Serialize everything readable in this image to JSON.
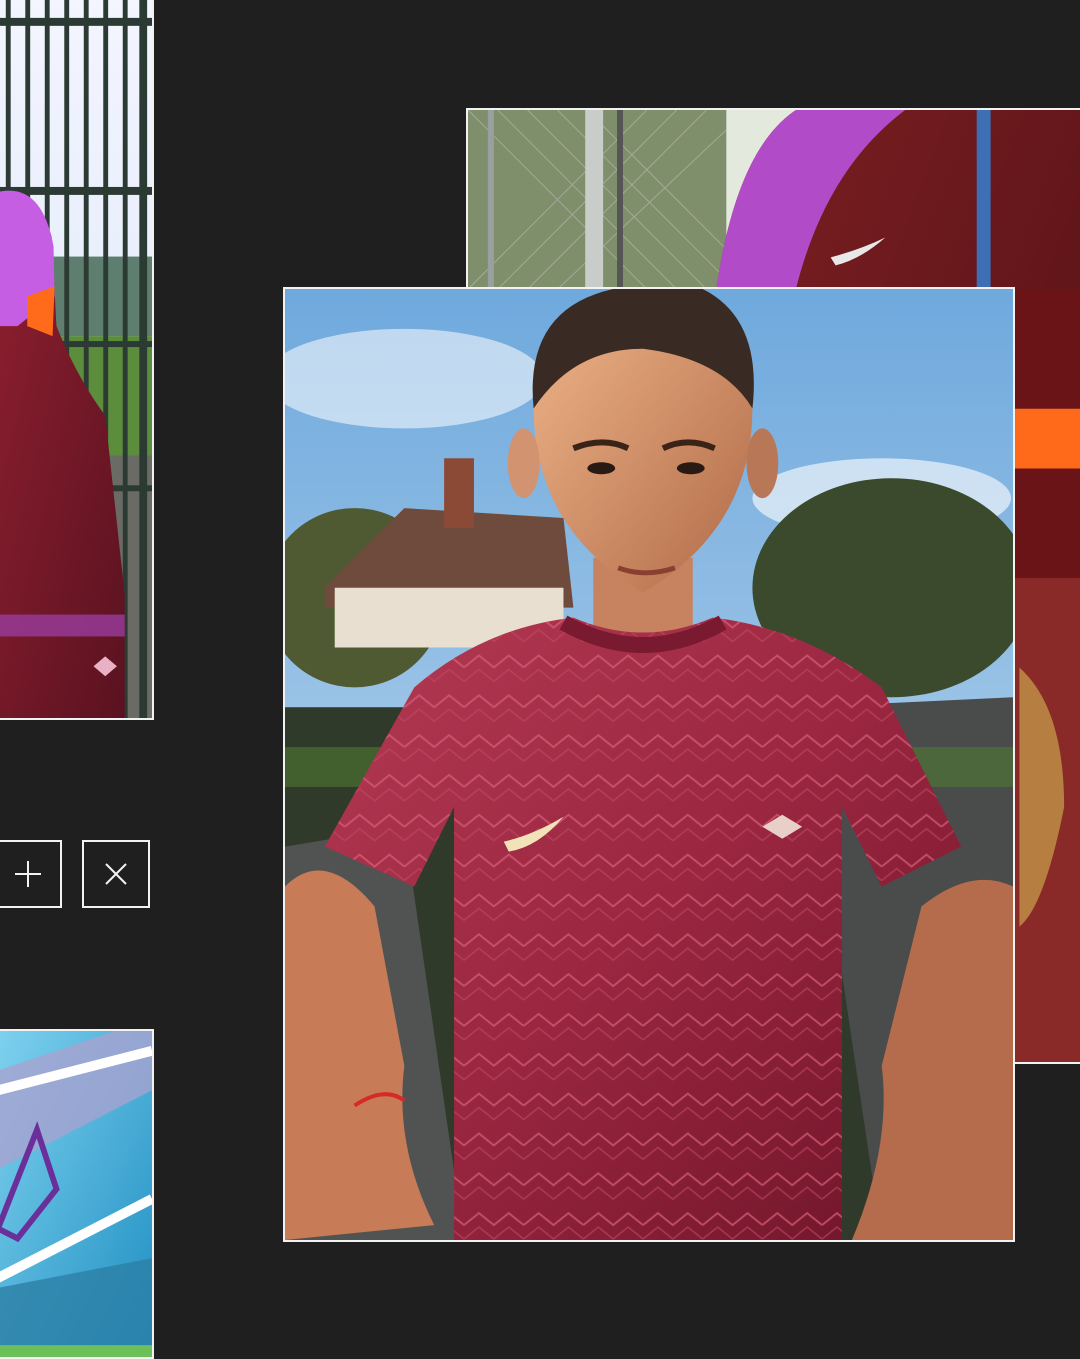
{
  "gallery": {
    "photos": [
      {
        "id": "top-left",
        "subject": "player-in-purple-maroon-tracksuit"
      },
      {
        "id": "top-right",
        "subject": "maroon-track-jacket-with-ball"
      },
      {
        "id": "main",
        "subject": "boy-in-patterned-maroon-shirt"
      },
      {
        "id": "bottom-left",
        "subject": "graffiti-wall"
      }
    ],
    "controls": {
      "add_icon": "plus-icon",
      "close_icon": "close-icon"
    }
  },
  "colors": {
    "background": "#1f1f1f",
    "frame": "#f2f2f2",
    "maroon": "#7a1e2e",
    "purple": "#b35ad6",
    "sky": "#8fc2e8"
  }
}
